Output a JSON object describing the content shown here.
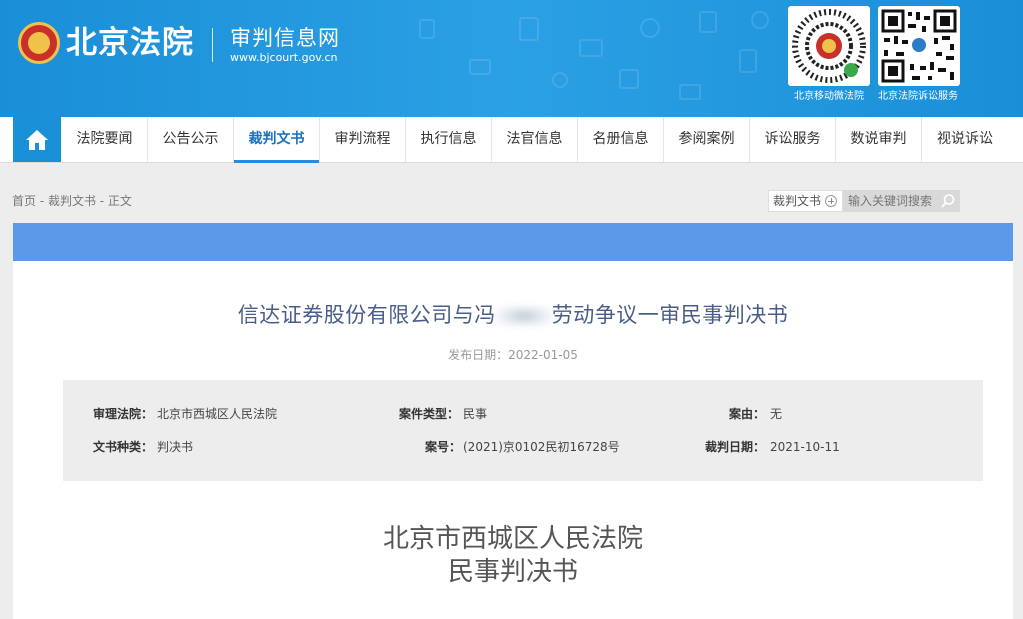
{
  "header": {
    "site_name": "北京法院",
    "sub_name": "审判信息网",
    "url": "www.bjcourt.gov.cn",
    "qr_left_caption": "北京移动微法院",
    "qr_right_caption": "北京法院诉讼服务"
  },
  "nav": {
    "home_icon": "home-icon",
    "items": [
      "法院要闻",
      "公告公示",
      "裁判文书",
      "审判流程",
      "执行信息",
      "法官信息",
      "名册信息",
      "参阅案例",
      "诉讼服务",
      "数说审判",
      "视说诉讼"
    ],
    "active": "裁判文书"
  },
  "breadcrumb": "首页 - 裁判文书 - 正文",
  "search": {
    "category": "裁判文书",
    "placeholder": "输入关键词搜索"
  },
  "document": {
    "title_part1": "信达证券股份有限公司与冯",
    "title_part2": "劳动争议一审民事判决书",
    "publish_date": "发布日期：2022-01-05",
    "meta": {
      "court_label": "审理法院：",
      "court_value": "北京市西城区人民法院",
      "case_type_label": "案件类型：",
      "case_type_value": "民事",
      "cause_label": "案由：",
      "cause_value": "无",
      "doc_type_label": "文书种类：",
      "doc_type_value": "判决书",
      "case_no_label": "案号：",
      "case_no_value": "(2021)京0102民初16728号",
      "judge_date_label": "裁判日期：",
      "judge_date_value": "2021-10-11"
    },
    "court_name": "北京市西城区人民法院",
    "doc_kind": "民事判决书"
  },
  "colors": {
    "header_blue": "#1a8fd8",
    "nav_home": "#1a90d8",
    "content_bar": "#5c9ae9",
    "title_color": "#4a5d88"
  }
}
